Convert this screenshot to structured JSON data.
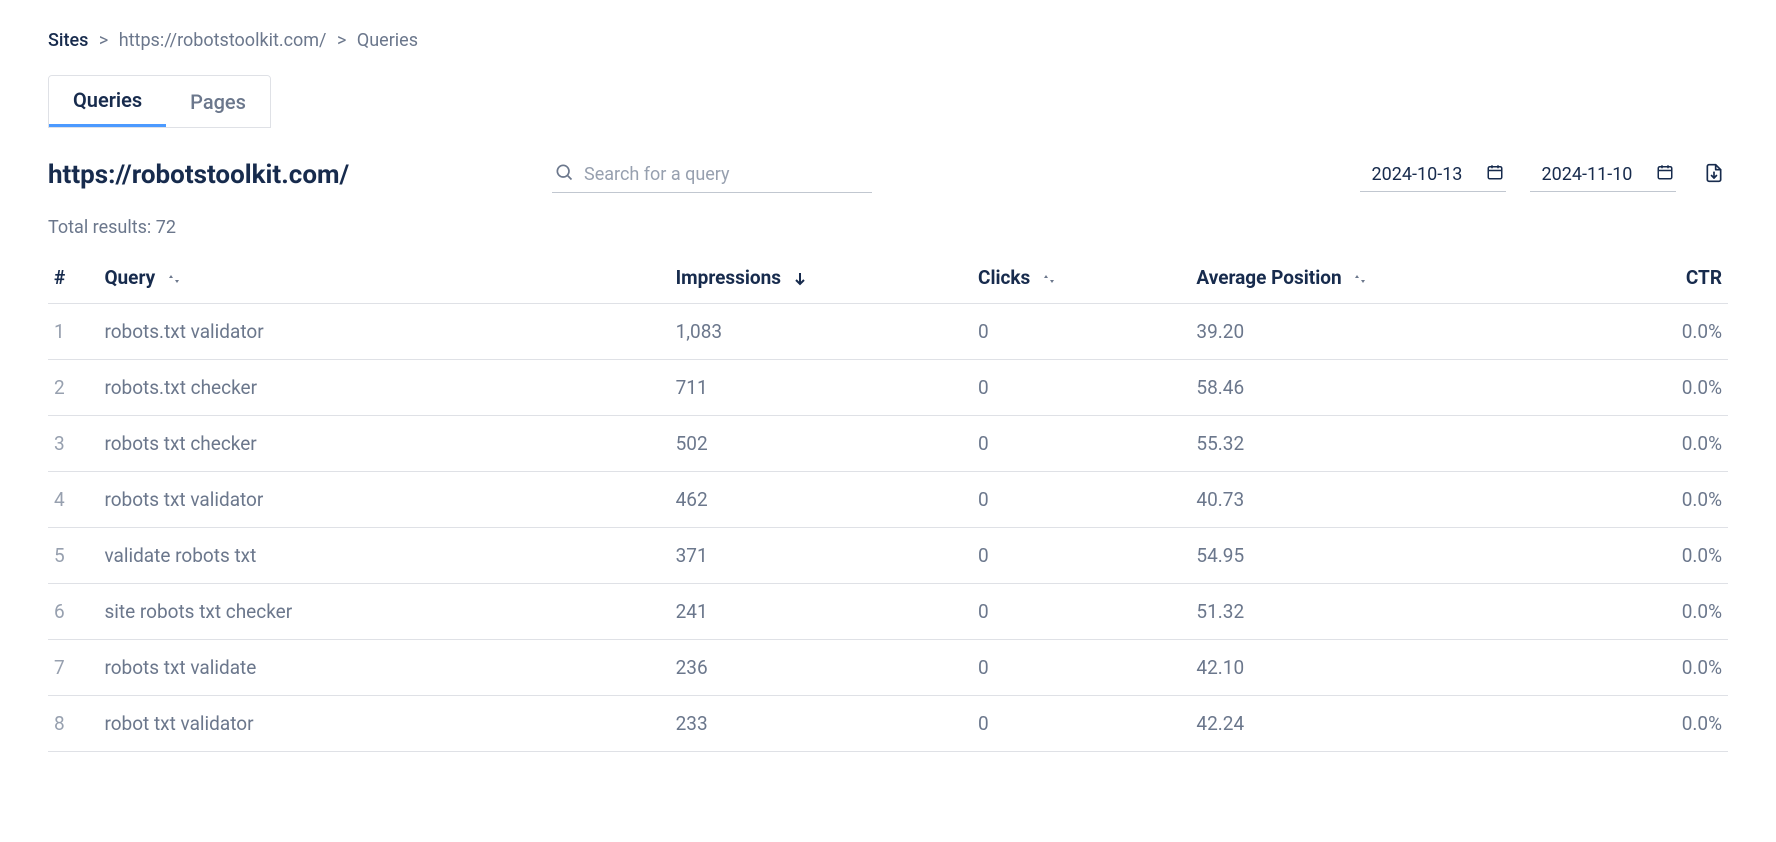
{
  "breadcrumb": {
    "sites": "Sites",
    "site_url": "https://robotstoolkit.com/",
    "current": "Queries"
  },
  "tabs": {
    "queries": "Queries",
    "pages": "Pages"
  },
  "page_title": "https://robotstoolkit.com/",
  "search": {
    "placeholder": "Search for a query",
    "value": ""
  },
  "dates": {
    "start": "2024-10-13",
    "end": "2024-11-10"
  },
  "total_results_label": "Total results: 72",
  "columns": {
    "index": "#",
    "query": "Query",
    "impressions": "Impressions",
    "clicks": "Clicks",
    "avg_position": "Average Position",
    "ctr": "CTR"
  },
  "rows": [
    {
      "idx": "1",
      "query": "robots.txt validator",
      "impressions": "1,083",
      "clicks": "0",
      "avg_position": "39.20",
      "ctr": "0.0%"
    },
    {
      "idx": "2",
      "query": "robots.txt checker",
      "impressions": "711",
      "clicks": "0",
      "avg_position": "58.46",
      "ctr": "0.0%"
    },
    {
      "idx": "3",
      "query": "robots txt checker",
      "impressions": "502",
      "clicks": "0",
      "avg_position": "55.32",
      "ctr": "0.0%"
    },
    {
      "idx": "4",
      "query": "robots txt validator",
      "impressions": "462",
      "clicks": "0",
      "avg_position": "40.73",
      "ctr": "0.0%"
    },
    {
      "idx": "5",
      "query": "validate robots txt",
      "impressions": "371",
      "clicks": "0",
      "avg_position": "54.95",
      "ctr": "0.0%"
    },
    {
      "idx": "6",
      "query": "site robots txt checker",
      "impressions": "241",
      "clicks": "0",
      "avg_position": "51.32",
      "ctr": "0.0%"
    },
    {
      "idx": "7",
      "query": "robots txt validate",
      "impressions": "236",
      "clicks": "0",
      "avg_position": "42.10",
      "ctr": "0.0%"
    },
    {
      "idx": "8",
      "query": "robot txt validator",
      "impressions": "233",
      "clicks": "0",
      "avg_position": "42.24",
      "ctr": "0.0%"
    }
  ]
}
